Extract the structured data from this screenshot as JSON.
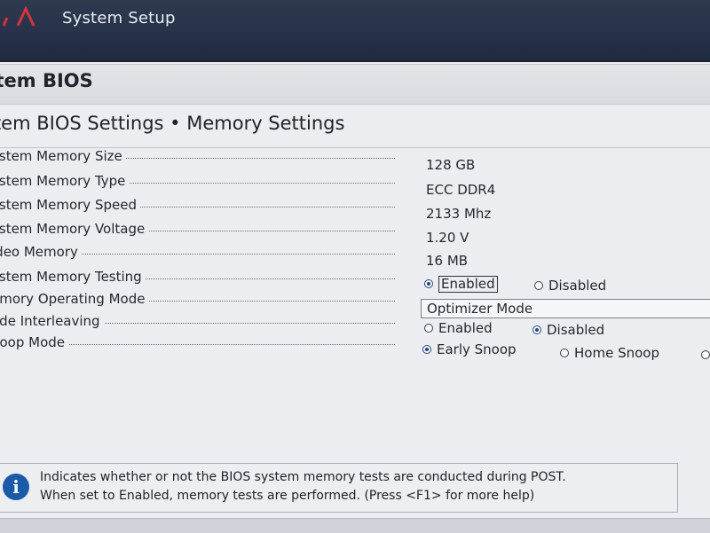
{
  "header": {
    "app_title": "System Setup"
  },
  "page": {
    "title": "stem BIOS",
    "section_title": "stem BIOS Settings • Memory Settings"
  },
  "settings": [
    {
      "label": "ystem Memory Size",
      "value": "128 GB"
    },
    {
      "label": "ystem Memory Type",
      "value": "ECC DDR4"
    },
    {
      "label": "ystem Memory Speed",
      "value": "2133 Mhz"
    },
    {
      "label": "ystem Memory Voltage",
      "value": "1.20 V"
    },
    {
      "label": "ideo Memory",
      "value": "16 MB"
    },
    {
      "label": "ystem Memory Testing",
      "options": [
        "Enabled",
        "Disabled"
      ],
      "selected": "Enabled"
    },
    {
      "label": "emory Operating Mode",
      "value": "Optimizer Mode"
    },
    {
      "label": "ode Interleaving",
      "options": [
        "Enabled",
        "Disabled"
      ],
      "selected": "Disabled"
    },
    {
      "label": "noop Mode",
      "options": [
        "Early Snoop",
        "Home Snoop"
      ],
      "selected": "Early Snoop"
    }
  ],
  "help": {
    "line1": "Indicates whether or not the BIOS system memory tests are conducted during POST.",
    "line2": "When set to Enabled, memory tests are performed. (Press <F1> for more help)"
  },
  "colors": {
    "topbar": "#2f3a4f",
    "logo": "#d6333d",
    "radio_selected": "#24477f",
    "info_icon": "#1a5aa8"
  }
}
